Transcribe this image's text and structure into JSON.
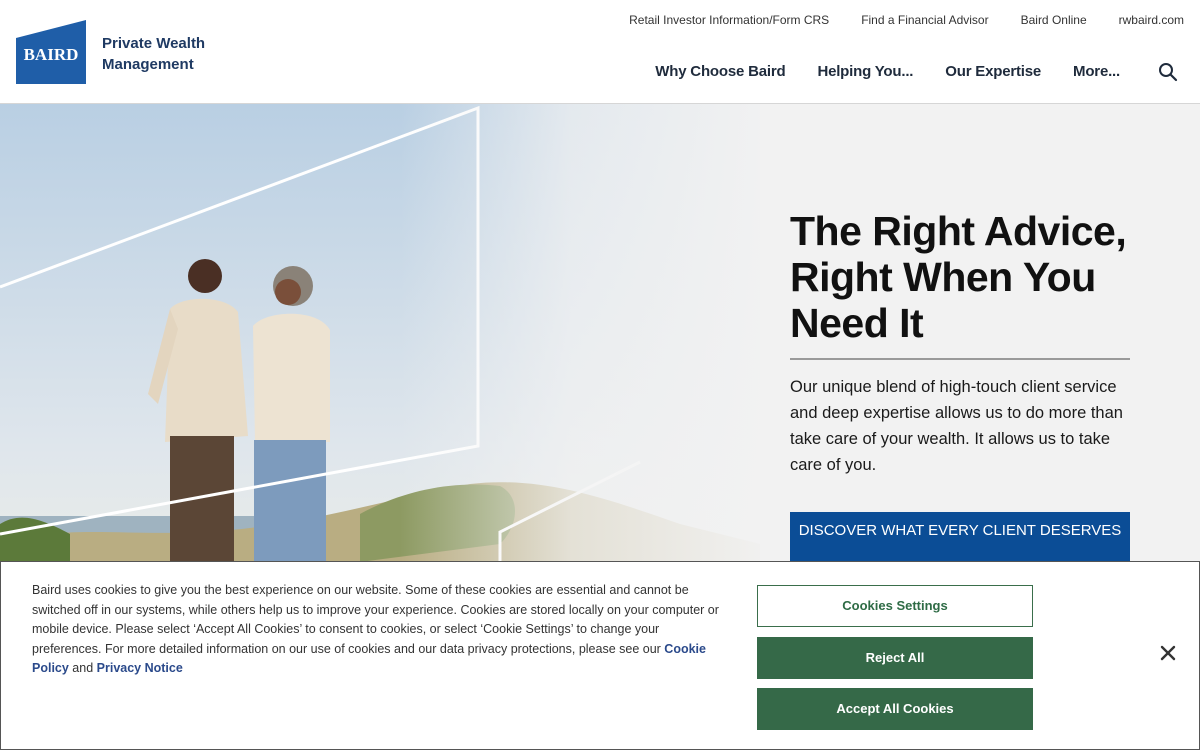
{
  "brand": {
    "logo_text": "BAIRD",
    "name_line1": "Private Wealth",
    "name_line2": "Management",
    "primary_color": "#1f3a63",
    "logo_color": "#1f5ea8"
  },
  "utility_nav": [
    {
      "label": "Retail Investor Information/Form CRS"
    },
    {
      "label": "Find a Financial Advisor"
    },
    {
      "label": "Baird Online"
    },
    {
      "label": "rwbaird.com"
    }
  ],
  "main_nav": [
    {
      "label": "Why Choose Baird"
    },
    {
      "label": "Helping You..."
    },
    {
      "label": "Our Expertise"
    },
    {
      "label": "More..."
    }
  ],
  "search": {
    "icon": "search-icon"
  },
  "hero": {
    "title": "The Right Advice, Right When You Need It",
    "body": "Our unique blend of high-touch client service and deep expertise allows us to do more than take care of your wealth. It allows us to take care of you.",
    "cta_label": "DISCOVER WHAT EVERY CLIENT DESERVES",
    "cta_color": "#0b4d96"
  },
  "cookie_banner": {
    "text_before": "Baird uses cookies to give you the best experience on our website. Some of these cookies are essential and cannot be switched off in our systems, while others help us to improve your experience. Cookies are stored locally on your computer or mobile device. Please select ‘Accept All Cookies’ to consent to cookies, or select ‘Cookie Settings’ to change your preferences. For more detailed information on our use of cookies and our data privacy protections, please see our ",
    "cookie_policy_link": "Cookie Policy",
    "and_text": " and ",
    "privacy_link": "Privacy Notice",
    "settings_label": "Cookies Settings",
    "reject_label": "Reject All",
    "accept_label": "Accept All Cookies",
    "close_icon": "close-icon",
    "button_color": "#356948"
  }
}
